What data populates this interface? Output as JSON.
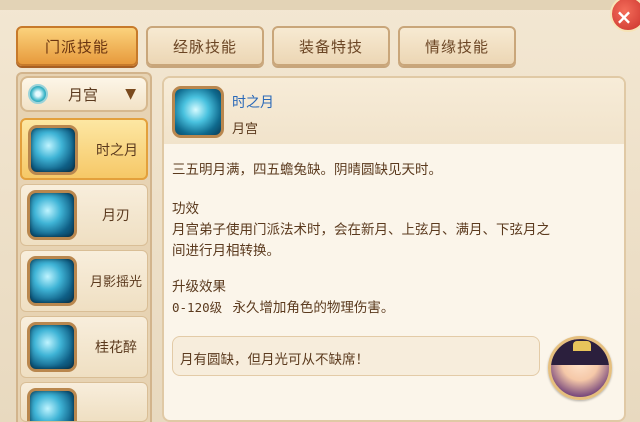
{
  "window": {
    "close_label": "×"
  },
  "tabs": [
    {
      "label": "门派技能",
      "active": true
    },
    {
      "label": "经脉技能",
      "active": false
    },
    {
      "label": "装备特技",
      "active": false
    },
    {
      "label": "情缘技能",
      "active": false
    }
  ],
  "sidebar": {
    "school": "月宫",
    "skills": [
      {
        "name": "时之月",
        "icon": "moon-crescent-icon",
        "active": true
      },
      {
        "name": "月刃",
        "icon": "moon-blade-icon",
        "active": false
      },
      {
        "name": "月影摇光",
        "icon": "moon-light-icon",
        "active": false
      },
      {
        "name": "桂花醉",
        "icon": "osmanthus-icon",
        "active": false
      },
      {
        "name": "",
        "icon": "skill-icon",
        "active": false
      }
    ]
  },
  "detail": {
    "title": "时之月",
    "school": "月宫",
    "description": "三五明月满，四五蟾兔缺。阴晴圆缺见天时。",
    "effect_heading": "功效",
    "effect_line1": "月宫弟子使用门派法术时，会在新月、上弦月、满月、下弦月之",
    "effect_line2": "间进行月相转换。",
    "upgrade_heading": "升级效果",
    "upgrade_range": "0-120级",
    "upgrade_text": "永久增加角色的物理伤害。"
  },
  "quote": {
    "text": "月有圆缺，但月光可从不缺席！"
  },
  "colors": {
    "accent_tab": "#e79a3c",
    "title_blue": "#2a69b8",
    "text_brown": "#5b3a1e"
  }
}
